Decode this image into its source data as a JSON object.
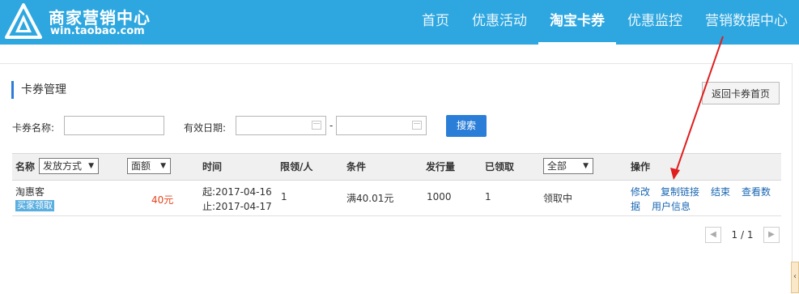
{
  "header": {
    "brand_title": "商家营销中心",
    "brand_url": "win.taobao.com",
    "nav": [
      {
        "label": "首页",
        "active": false
      },
      {
        "label": "优惠活动",
        "active": false
      },
      {
        "label": "淘宝卡券",
        "active": true
      },
      {
        "label": "优惠监控",
        "active": false
      },
      {
        "label": "营销数据中心",
        "active": false
      }
    ]
  },
  "section": {
    "title": "卡券管理",
    "back_button": "返回卡券首页"
  },
  "filters": {
    "name_label": "卡券名称:",
    "name_value": "",
    "date_label": "有效日期:",
    "date_start": "",
    "date_end": "",
    "date_sep": "-",
    "search_button": "搜索"
  },
  "table": {
    "col_name": "名称",
    "issue_select": "发放方式",
    "amount_select": "面额",
    "col_time": "时间",
    "col_limit": "限领/人",
    "col_condition": "条件",
    "col_issued": "发行量",
    "col_claimed": "已领取",
    "status_select": "全部",
    "col_action": "操作",
    "rows": [
      {
        "name": "淘惠客",
        "tag": "买家领取",
        "amount": "40元",
        "start": "起:2017-04-16",
        "end": "止:2017-04-17",
        "limit": "1",
        "condition": "满40.01元",
        "issued": "1000",
        "claimed": "1",
        "status": "领取中",
        "actions": {
          "edit": "修改",
          "copy": "复制链接",
          "finish": "结束",
          "view1": "查看数",
          "view2": "据",
          "user": "用户信息"
        }
      }
    ]
  },
  "pager": {
    "text": "1 / 1",
    "prev_icon": "chevron-left",
    "next_icon": "chevron-right"
  },
  "colors": {
    "header": "#2ea7e0",
    "primary": "#2b7ed8",
    "link": "#1a67b3",
    "amount": "#e5441b",
    "annotation": "#e01e1e"
  }
}
